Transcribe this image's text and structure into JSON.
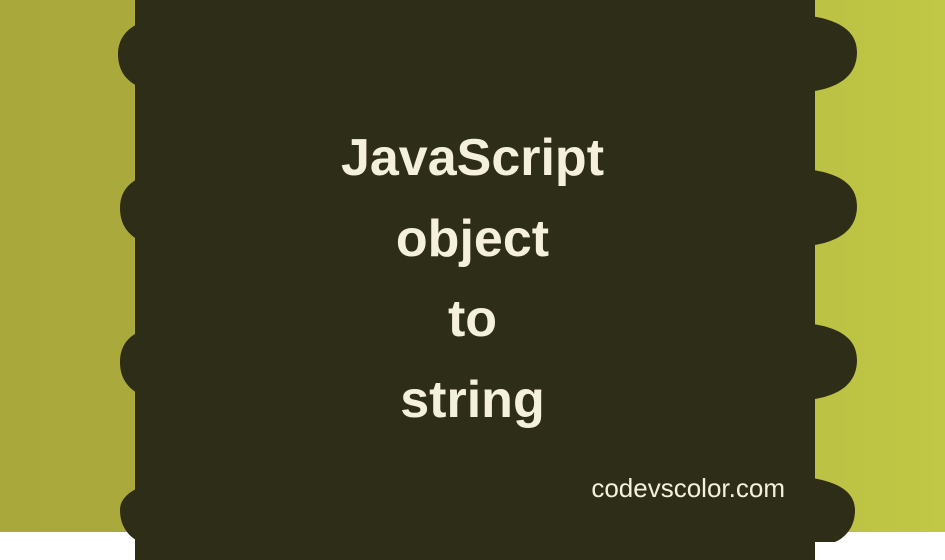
{
  "title": {
    "line1": "JavaScript",
    "line2": "object",
    "line3": "to",
    "line4": "string"
  },
  "watermark": "codevscolor.com",
  "colors": {
    "blob_dark": "#2e2d18",
    "bg_left": "#a8a83b",
    "bg_right": "#c0c845",
    "text": "#f5f0dc"
  }
}
